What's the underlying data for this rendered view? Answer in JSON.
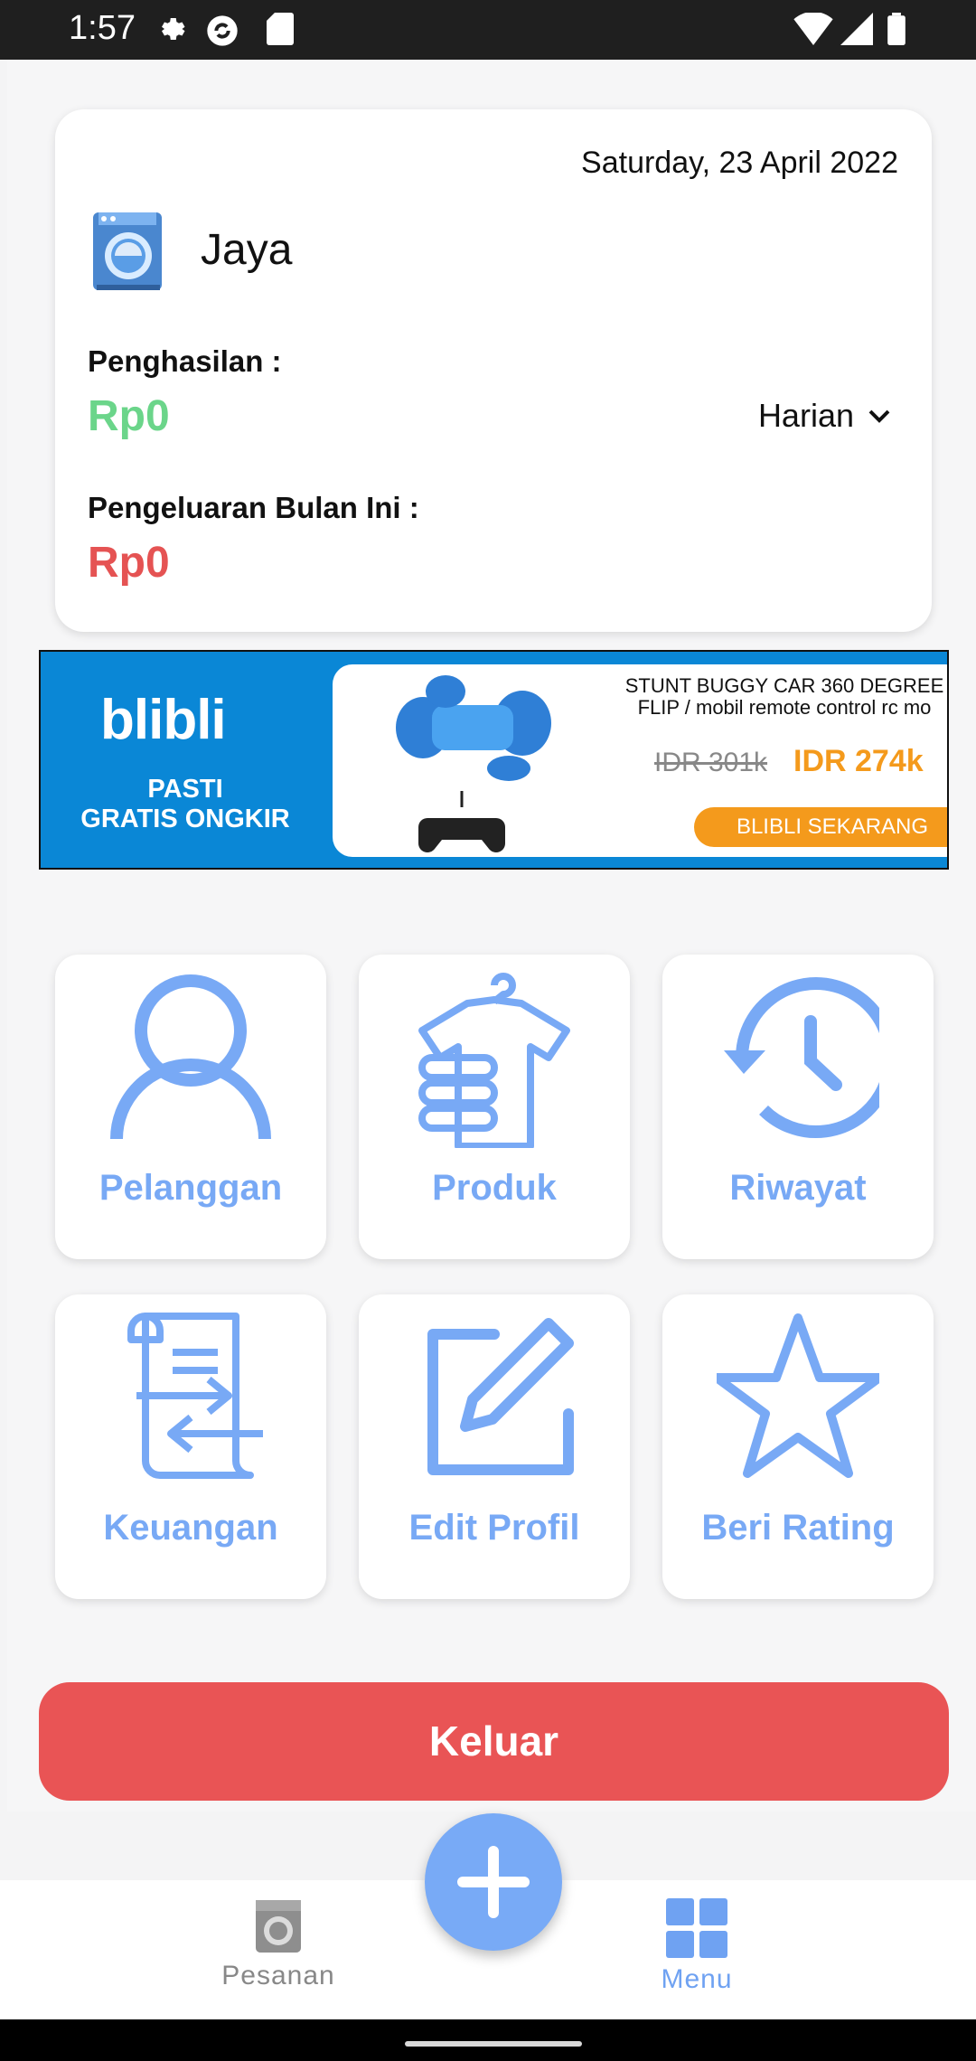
{
  "status_bar": {
    "time": "1:57"
  },
  "summary": {
    "date": "Saturday, 23 April 2022",
    "name": "Jaya",
    "income_label": "Penghasilan :",
    "income_value": "Rp0",
    "period": "Harian",
    "expense_label": "Pengeluaran Bulan Ini :",
    "expense_value": "Rp0"
  },
  "ad": {
    "brand": "blibli",
    "tagline_1": "PASTI",
    "tagline_2": "GRATIS ONGKIR",
    "product_title_1": "STUNT BUGGY CAR 360 DEGREE",
    "product_title_2": "FLIP / mobil remote control rc mo",
    "old_price": "IDR 301k",
    "new_price": "IDR 274k",
    "cta": "BLIBLI SEKARANG"
  },
  "menu": [
    {
      "label": "Pelanggan",
      "icon": "person-icon"
    },
    {
      "label": "Produk",
      "icon": "shirt-icon"
    },
    {
      "label": "Riwayat",
      "icon": "history-icon"
    },
    {
      "label": "Keuangan",
      "icon": "transfer-document-icon"
    },
    {
      "label": "Edit Profil",
      "icon": "edit-icon"
    },
    {
      "label": "Beri Rating",
      "icon": "star-icon"
    }
  ],
  "logout_label": "Keluar",
  "bottom_nav": [
    {
      "label": "Pesanan",
      "icon": "washing-machine-icon",
      "active": false
    },
    {
      "label": "Menu",
      "icon": "grid-icon",
      "active": true
    }
  ],
  "colors": {
    "accent": "#78a9f5",
    "income": "#6bd58a",
    "expense": "#e55353",
    "logout": "#e95455"
  }
}
